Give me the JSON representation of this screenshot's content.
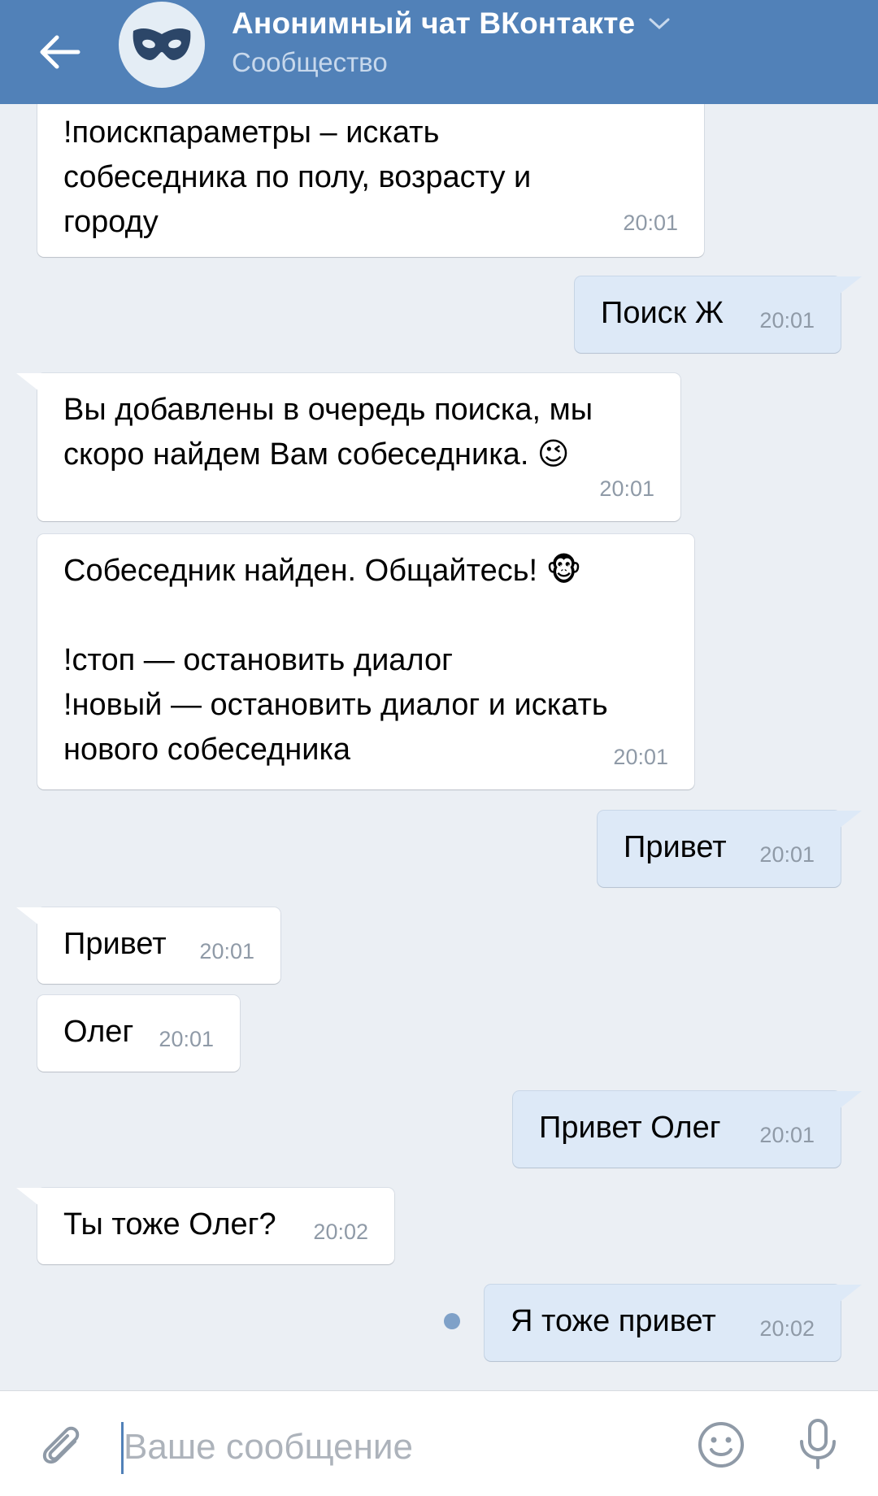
{
  "header": {
    "title": "Анонимный чат ВКонтакте",
    "subtitle": "Сообщество",
    "brand_color": "#5181b8",
    "avatar_icon": "mask-icon",
    "back_icon": "arrow-left-icon",
    "chevron_icon": "chevron-down-icon"
  },
  "messages": [
    {
      "dir": "in",
      "text": "!поискпараметры – искать\nсобеседника по полу, возрасту и\nгороду",
      "time": "20:01"
    },
    {
      "dir": "out",
      "text": "Поиск Ж",
      "time": "20:01"
    },
    {
      "dir": "in",
      "text": "Вы добавлены в очередь поиска, мы\nскоро найдем Вам собеседника. 😉",
      "time": "20:01"
    },
    {
      "dir": "in",
      "text": "Собеседник найден. Общайтесь! 🐵\n\n!стоп — остановить диалог\n!новый — остановить диалог и искать\nнового собеседника",
      "time": "20:01"
    },
    {
      "dir": "out",
      "text": "Привет",
      "time": "20:01"
    },
    {
      "dir": "in",
      "text": "Привет",
      "time": "20:01"
    },
    {
      "dir": "in",
      "text": "Олег",
      "time": "20:01"
    },
    {
      "dir": "out",
      "text": "Привет Олег",
      "time": "20:01"
    },
    {
      "dir": "in",
      "text": "Ты тоже Олег?",
      "time": "20:02"
    },
    {
      "dir": "out",
      "text": "Я тоже привет",
      "time": "20:02",
      "unread": true
    }
  ],
  "composer": {
    "placeholder": "Ваше сообщение",
    "attach_icon": "paperclip-icon",
    "emoji_icon": "smile-icon",
    "mic_icon": "microphone-icon"
  },
  "colors": {
    "background": "#ebeff4",
    "incoming_bubble": "#ffffff",
    "outgoing_bubble": "#dde9f7",
    "unread_dot": "#7fa1c8"
  }
}
